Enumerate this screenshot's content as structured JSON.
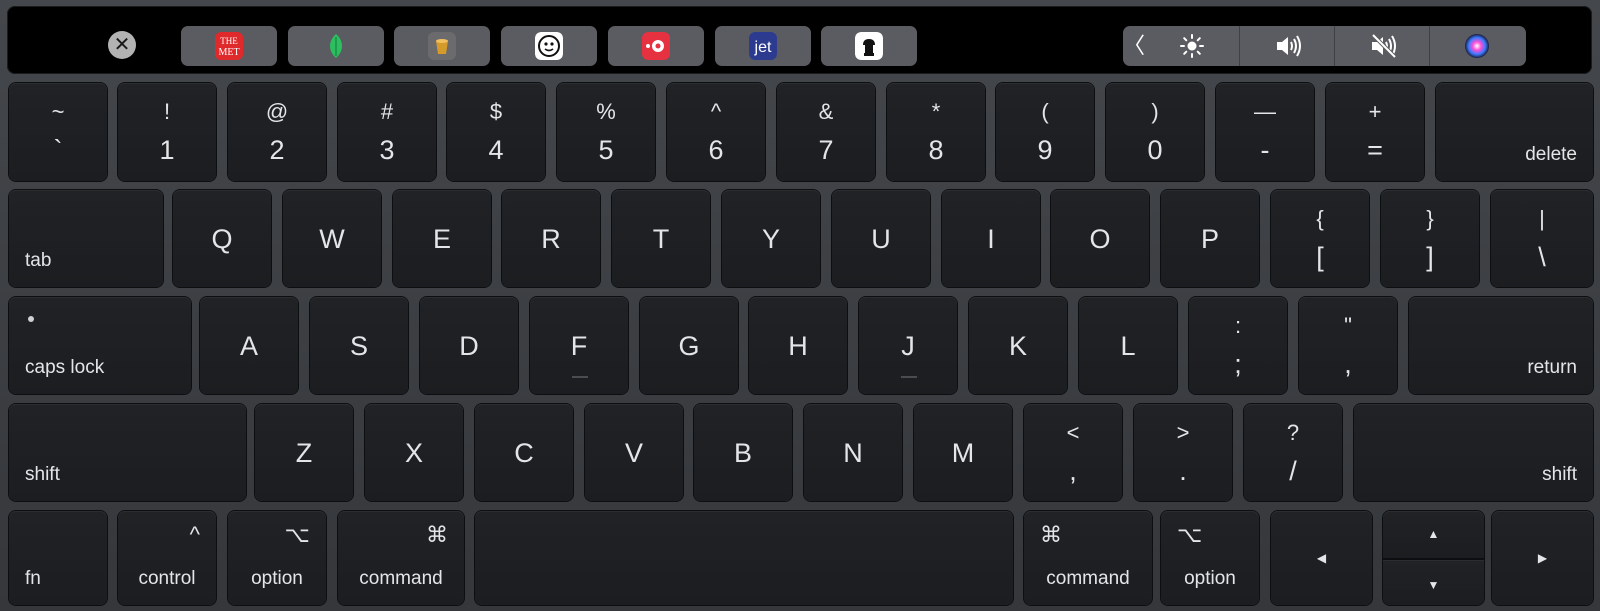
{
  "touchbar": {
    "esc_glyph": "✕",
    "apps": [
      {
        "name": "the-met-app",
        "icon": "the-met-icon",
        "text": "THE MET",
        "color": "#e0292b"
      },
      {
        "name": "evernote-app",
        "icon": "leaf-icon",
        "color": "#2dbe60"
      },
      {
        "name": "bucket-app",
        "icon": "bucket-icon",
        "color": "#d49a2a"
      },
      {
        "name": "avatar-app",
        "icon": "avatar-icon",
        "color": "#ffffff"
      },
      {
        "name": "record-app",
        "icon": "record-icon",
        "color": "#e63140"
      },
      {
        "name": "jet-app",
        "icon": "jet-icon",
        "text": "jet",
        "color": "#2c3b8f"
      },
      {
        "name": "chef-app",
        "icon": "chef-icon",
        "color": "#ffffff"
      }
    ],
    "chevron": "〈",
    "controls": [
      "brightness-icon",
      "volume-icon",
      "mute-icon",
      "siri-icon"
    ]
  },
  "rows": {
    "numbers": [
      {
        "top": "~",
        "bottom": "`"
      },
      {
        "top": "!",
        "bottom": "1"
      },
      {
        "top": "@",
        "bottom": "2"
      },
      {
        "top": "#",
        "bottom": "3"
      },
      {
        "top": "$",
        "bottom": "4"
      },
      {
        "top": "%",
        "bottom": "5"
      },
      {
        "top": "^",
        "bottom": "6"
      },
      {
        "top": "&",
        "bottom": "7"
      },
      {
        "top": "*",
        "bottom": "8"
      },
      {
        "top": "(",
        "bottom": "9"
      },
      {
        "top": ")",
        "bottom": "0"
      },
      {
        "top": "—",
        "bottom": "-"
      },
      {
        "top": "+",
        "bottom": "="
      }
    ],
    "delete": "delete",
    "tab": "tab",
    "qwerty": [
      "Q",
      "W",
      "E",
      "R",
      "T",
      "Y",
      "U",
      "I",
      "O",
      "P"
    ],
    "brackets": [
      {
        "top": "{",
        "bottom": "["
      },
      {
        "top": "}",
        "bottom": "]"
      },
      {
        "top": "|",
        "bottom": "\\"
      }
    ],
    "caps_lock": "caps lock",
    "asdf": [
      "A",
      "S",
      "D",
      "F",
      "G",
      "H",
      "J",
      "K",
      "L"
    ],
    "semicolon": {
      "top": ":",
      "bottom": ";"
    },
    "quote": {
      "top": "\"",
      "bottom": ","
    },
    "return": "return",
    "shift": "shift",
    "zxcv": [
      "Z",
      "X",
      "C",
      "V",
      "B",
      "N",
      "M"
    ],
    "punct": [
      {
        "top": "<",
        "bottom": ","
      },
      {
        "top": ">",
        "bottom": "."
      },
      {
        "top": "?",
        "bottom": "/"
      }
    ],
    "fn": "fn",
    "control": {
      "label": "control",
      "symbol": "^"
    },
    "option": {
      "label": "option",
      "symbol": "⌥"
    },
    "command": {
      "label": "command",
      "symbol": "⌘"
    },
    "arrows": {
      "left": "◀",
      "up": "▲",
      "down": "▼",
      "right": "▶"
    }
  }
}
